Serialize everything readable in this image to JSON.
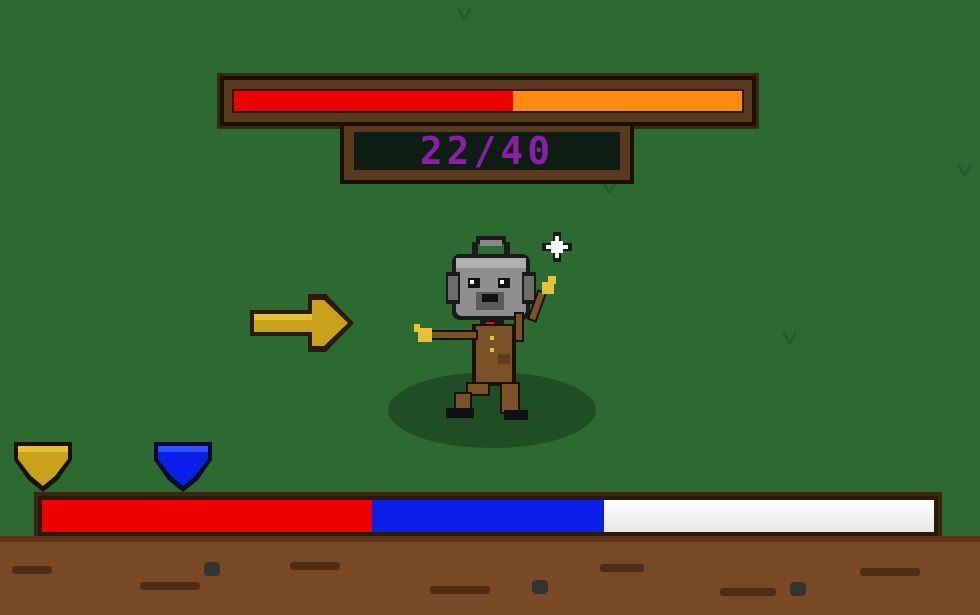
{
  "hud": {
    "health_text": "22/40",
    "health_current": 22,
    "health_max": 40,
    "health_fill_color": "#ee0000",
    "health_empty_color": "#ff8a10",
    "health_text_color": "#8a1fa6"
  },
  "bottom_bar": {
    "red_fraction": 0.37,
    "blue_fraction": 0.26,
    "white_fraction": 0.37,
    "colors": [
      "#ee0000",
      "#0a20e8",
      "#ffffff"
    ]
  },
  "gems": [
    {
      "name": "gold",
      "color": "#c9a21b"
    },
    {
      "name": "blue",
      "color": "#0a20e8"
    }
  ],
  "icons": [
    "pointer-arrow-icon",
    "sparkle-icon",
    "gold-gem-icon",
    "blue-gem-icon"
  ],
  "colors": {
    "grass": "#2c6a31",
    "dirt": "#7a4a26"
  }
}
